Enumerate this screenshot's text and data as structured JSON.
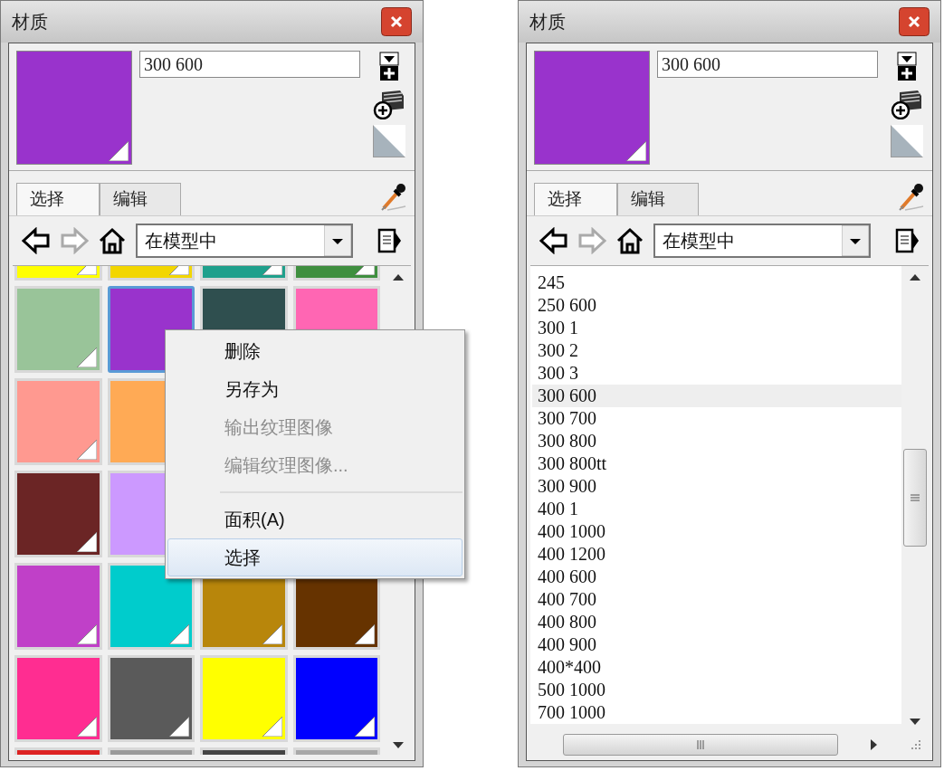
{
  "panels": [
    {
      "title": "材质",
      "material_name": "300 600",
      "preview": {
        "color": "#9933cc"
      },
      "tabs": [
        {
          "label": "选择",
          "selected": true
        },
        {
          "label": "编辑",
          "selected": false
        }
      ],
      "location": "在模型中",
      "swatch_rows": [
        [
          {
            "color": "#ffff00",
            "selected": false
          },
          {
            "color": "#f2d600",
            "selected": false
          },
          {
            "color": "#1fa08c",
            "selected": false
          },
          {
            "color": "#3f8f3f",
            "selected": false
          }
        ],
        [
          {
            "color": "#99c499",
            "selected": false
          },
          {
            "color": "#9933cc",
            "selected": true
          },
          {
            "color": "#2f4f4f",
            "selected": false
          },
          {
            "color": "#ff66b3",
            "selected": false
          }
        ],
        [
          {
            "color": "#ff9990",
            "selected": false
          },
          {
            "color": "#ffaa55",
            "selected": false
          }
        ],
        [
          {
            "color": "#6b2525",
            "selected": false
          },
          {
            "color": "#cc99ff",
            "selected": false
          }
        ],
        [
          {
            "color": "#c040c8",
            "selected": false
          },
          {
            "color": "#00cccc",
            "selected": false
          },
          {
            "color": "#b8860b",
            "selected": false
          },
          {
            "color": "#663300",
            "selected": false
          }
        ],
        [
          {
            "color": "#ff2d91",
            "selected": false
          },
          {
            "color": "#5a5a5a",
            "selected": false
          },
          {
            "color": "#ffff00",
            "selected": false
          },
          {
            "color": "#0000ff",
            "selected": false
          }
        ],
        [
          {
            "color": "#dd2222",
            "selected": false
          },
          {
            "color": "#9a9a9a",
            "selected": false
          },
          {
            "color": "#444444",
            "selected": false
          },
          {
            "color": "#a8a8a8",
            "selected": false
          }
        ]
      ],
      "context_menu": [
        {
          "kind": "item",
          "label": "删除",
          "disabled": false,
          "selected": false
        },
        {
          "kind": "item",
          "label": "另存为",
          "disabled": false,
          "selected": false
        },
        {
          "kind": "item",
          "label": "输出纹理图像",
          "disabled": true,
          "selected": false
        },
        {
          "kind": "item",
          "label": "编辑纹理图像...",
          "disabled": true,
          "selected": false
        },
        {
          "kind": "separator"
        },
        {
          "kind": "item",
          "label": "面积(A)",
          "disabled": false,
          "selected": false
        },
        {
          "kind": "item",
          "label": "选择",
          "disabled": false,
          "selected": true
        }
      ]
    },
    {
      "title": "材质",
      "material_name": "300 600",
      "preview": {
        "color": "#9933cc"
      },
      "tabs": [
        {
          "label": "选择",
          "selected": true
        },
        {
          "label": "编辑",
          "selected": false
        }
      ],
      "location": "在模型中",
      "list_items": [
        {
          "label": "245",
          "selected": false
        },
        {
          "label": "250 600",
          "selected": false
        },
        {
          "label": "300 1",
          "selected": false
        },
        {
          "label": "300 2",
          "selected": false
        },
        {
          "label": "300 3",
          "selected": false
        },
        {
          "label": "300 600",
          "selected": true
        },
        {
          "label": "300 700",
          "selected": false
        },
        {
          "label": "300 800",
          "selected": false
        },
        {
          "label": "300 800tt",
          "selected": false
        },
        {
          "label": "300 900",
          "selected": false
        },
        {
          "label": "400 1",
          "selected": false
        },
        {
          "label": "400 1000",
          "selected": false
        },
        {
          "label": "400 1200",
          "selected": false
        },
        {
          "label": "400 600",
          "selected": false
        },
        {
          "label": "400 700",
          "selected": false
        },
        {
          "label": "400 800",
          "selected": false
        },
        {
          "label": "400 900",
          "selected": false
        },
        {
          "label": "400*400",
          "selected": false
        },
        {
          "label": "500 1000",
          "selected": false
        },
        {
          "label": "700 1000",
          "selected": false
        }
      ]
    }
  ]
}
